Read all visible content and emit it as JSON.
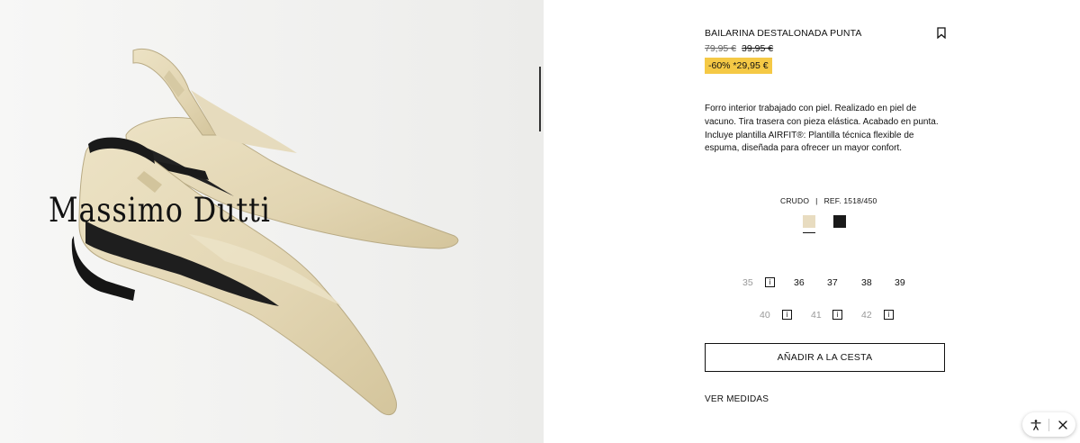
{
  "brand": {
    "logo_text": "Massimo Dutti"
  },
  "product": {
    "title": "BAILARINA DESTALONADA PUNTA",
    "original_price": "79,95 €",
    "previous_price": "39,95 €",
    "discount_label": "-60% *29,95 €",
    "description": "Forro interior trabajado con piel. Realizado en piel de vacuno. Tira trasera con pieza elástica. Acabado en punta. Incluye plantilla AIRFIT®: Plantilla técnica flexible de espuma, diseñada para ofrecer un mayor confort.",
    "color_name": "CRUDO",
    "separator": "|",
    "reference": "REF. 1518/450",
    "colors": [
      {
        "name": "crudo",
        "hex": "#e8dcc0",
        "selected": true
      },
      {
        "name": "negro",
        "hex": "#1a1a1a",
        "selected": false
      }
    ]
  },
  "sizes": {
    "s35": "35",
    "s36": "36",
    "s37": "37",
    "s38": "38",
    "s39": "39",
    "s40": "40",
    "s41": "41",
    "s42": "42",
    "info_glyph": "i"
  },
  "actions": {
    "add_to_cart": "AÑADIR A LA CESTA",
    "see_measures": "VER MEDIDAS"
  },
  "icons": {
    "bookmark": "bookmark-icon",
    "accessibility": "accessibility-icon",
    "close": "close-icon",
    "info": "info-icon"
  },
  "colors": {
    "discount_bg": "#f5c945",
    "image_bg": "#f1f1ef"
  }
}
